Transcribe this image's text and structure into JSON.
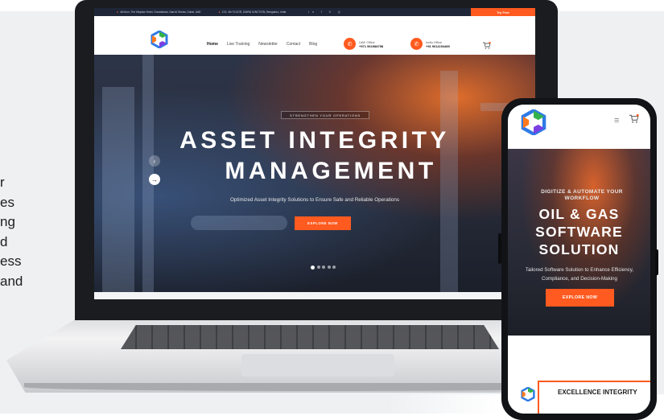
{
  "side_text": {
    "lines": [
      "r",
      "es",
      "ng",
      "d",
      "ess",
      "and"
    ]
  },
  "laptop": {
    "topbar": {
      "address_1": "4th floor, The Meydan Hotel, Grandstand, Nad Al Sheba, Dubai, UAE",
      "address_2": "C/O, 4th FLOOR, DAIRA JUNCTION, Bengaluru, India",
      "socials": "in f X ◎",
      "free_trial": "Try Free"
    },
    "nav": {
      "items": [
        "Home",
        "Live Training",
        "Newsletter",
        "Contact",
        "Blog"
      ]
    },
    "offices": [
      {
        "label": "UAE Office",
        "phone": "+971 561988758"
      },
      {
        "label": "India Office",
        "phone": "+91 9611154485"
      }
    ],
    "hero": {
      "tag": "STRENGTHEN YOUR OPERATIONS",
      "title_line1": "ASSET INTEGRITY",
      "title_line2": "MANAGEMENT",
      "subtitle": "Optimized Asset Integrity Solutions to Ensure Safe and Reliable Operations",
      "button": "EXPLORE NOW",
      "prev_arrow": "‹",
      "next_arrow": "→"
    }
  },
  "phone": {
    "hero": {
      "tag_line1": "DIGITIZE & AUTOMATE YOUR",
      "tag_line2": "WORKFLOW",
      "title_line1": "OIL & GAS",
      "title_line2": "SOFTWARE",
      "title_line3": "SOLUTION",
      "subtitle_line1": "Tailored Software Solution to Enhance Efficiency,",
      "subtitle_line2": "Compliance, and Decision-Making",
      "button": "EXPLORE NOW"
    },
    "card_title": "EXCELLENCE INTEGRITY"
  },
  "colors": {
    "accent": "#ff5a1f",
    "dark_bar": "#1e2638"
  },
  "icons": [
    "location-pin-icon",
    "phone-icon",
    "cart-icon",
    "menu-icon",
    "arrow-left-icon",
    "arrow-right-icon",
    "logo-hexagon-icon"
  ]
}
